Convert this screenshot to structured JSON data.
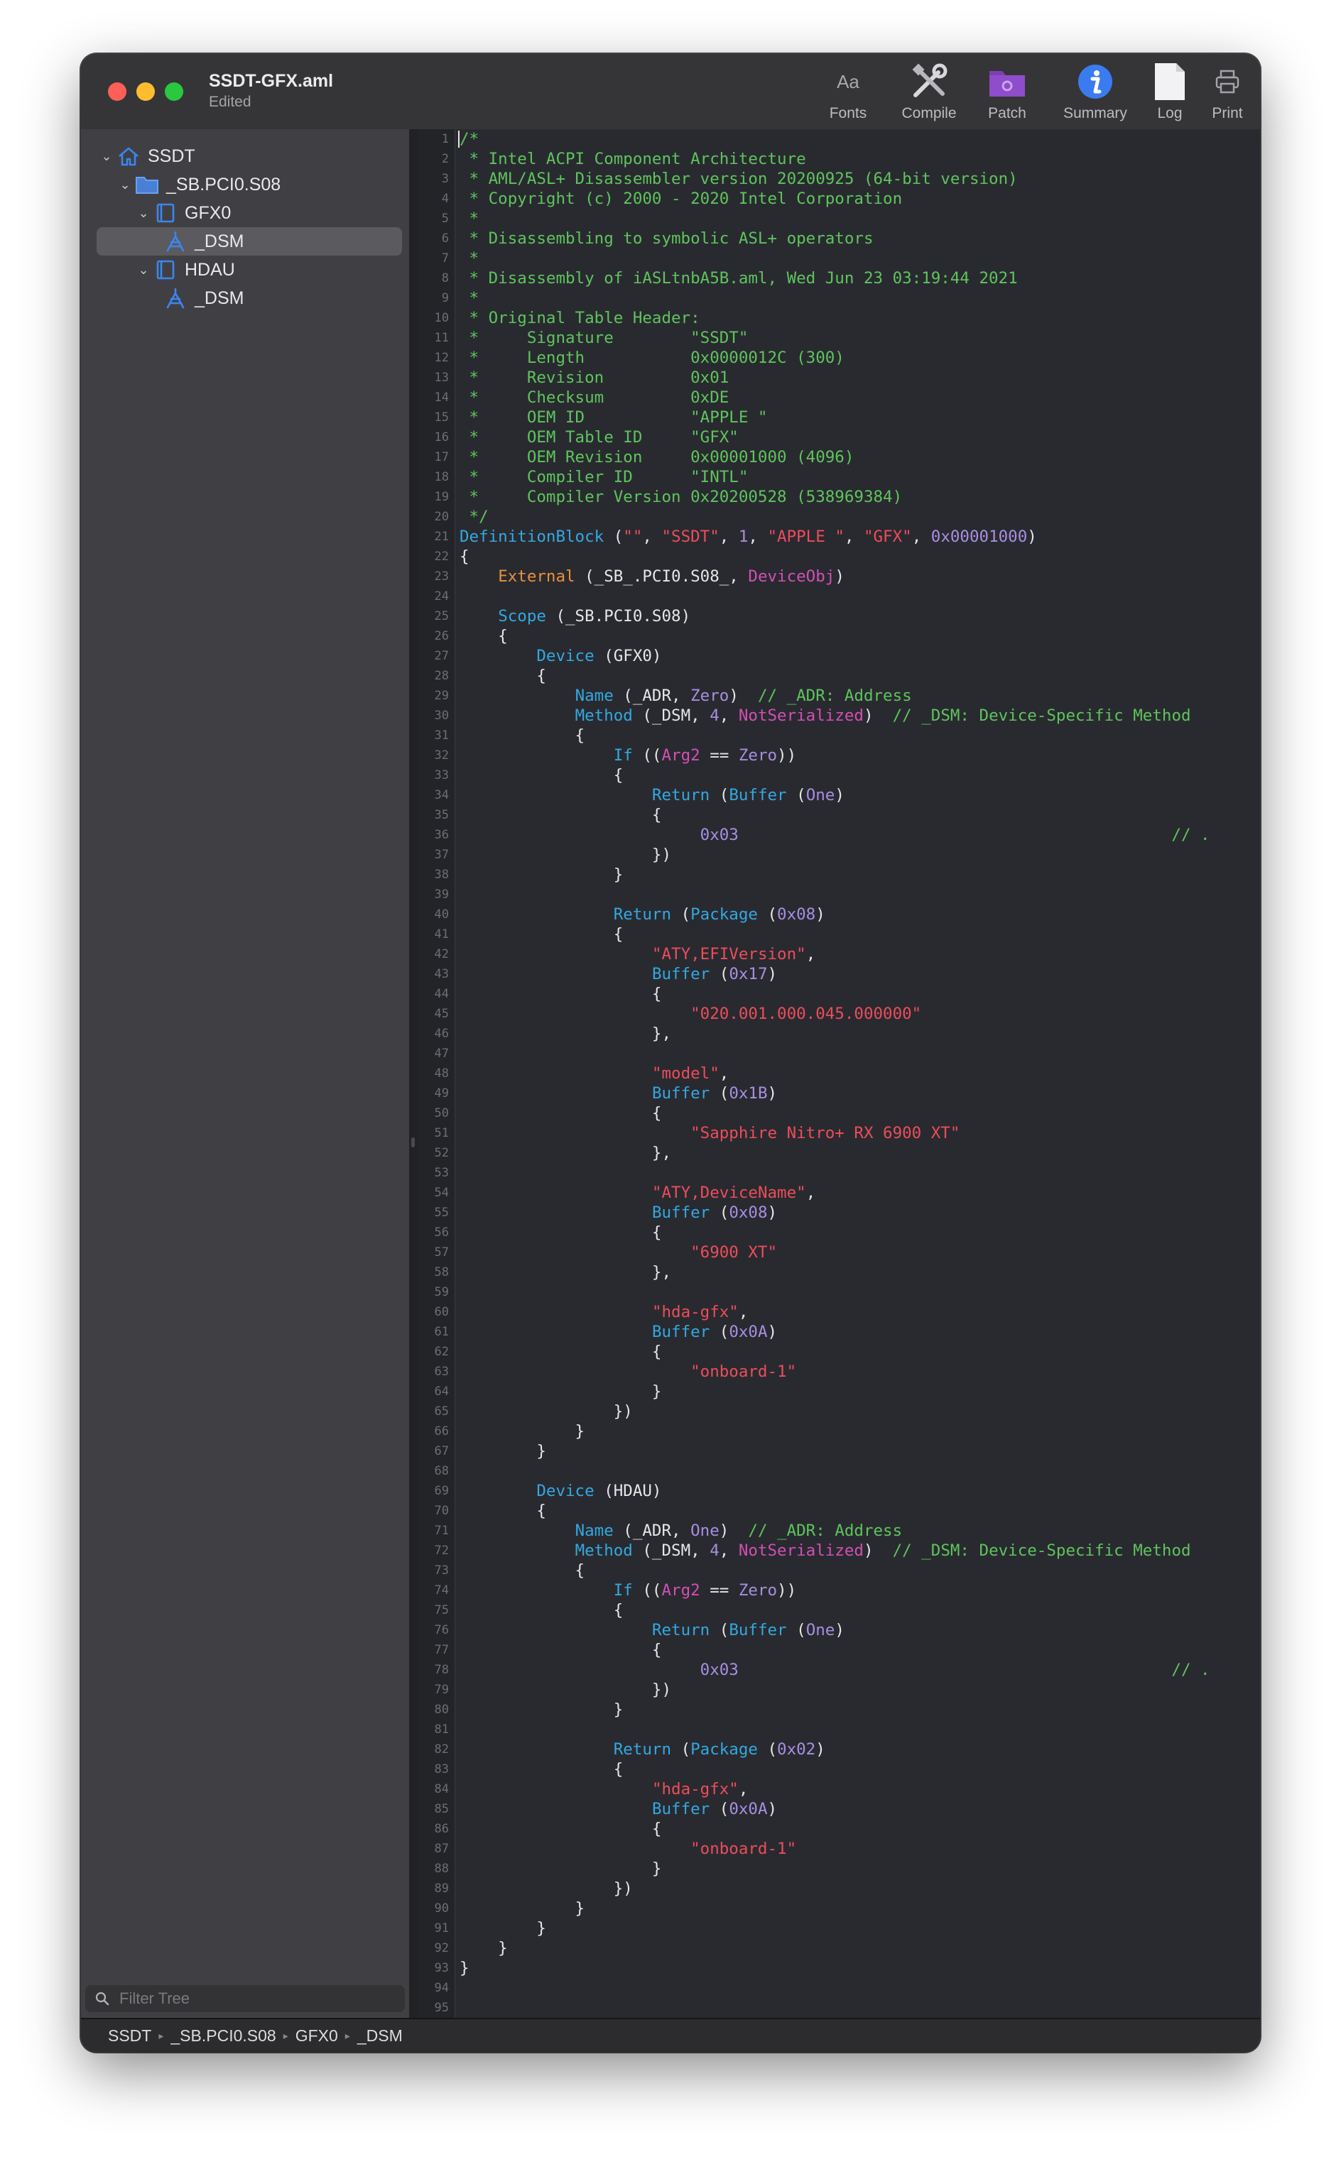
{
  "window": {
    "title": "SSDT-GFX.aml",
    "subtitle": "Edited"
  },
  "toolbar": {
    "fonts_label": "Fonts",
    "fonts_glyph": "Aa",
    "compile_label": "Compile",
    "patch_label": "Patch",
    "summary_label": "Summary",
    "log_label": "Log",
    "print_label": "Print"
  },
  "tree": [
    {
      "label": "SSDT",
      "icon": "house-icon",
      "expanded": true
    },
    {
      "label": "_SB.PCI0.S08",
      "icon": "folder-icon",
      "expanded": true
    },
    {
      "label": "GFX0",
      "icon": "device-icon",
      "expanded": true
    },
    {
      "label": "_DSM",
      "icon": "method-icon",
      "selected": true
    },
    {
      "label": "HDAU",
      "icon": "device-icon",
      "expanded": true
    },
    {
      "label": "_DSM",
      "icon": "method-icon"
    }
  ],
  "filter": {
    "placeholder": "Filter Tree"
  },
  "breadcrumb": [
    "SSDT",
    "_SB.PCI0.S08",
    "GFX0",
    "_DSM"
  ],
  "line_count": 95,
  "code_lines": [
    "/*",
    " * Intel ACPI Component Architecture",
    " * AML/ASL+ Disassembler version 20200925 (64-bit version)",
    " * Copyright (c) 2000 - 2020 Intel Corporation",
    " *",
    " * Disassembling to symbolic ASL+ operators",
    " *",
    " * Disassembly of iASLtnbA5B.aml, Wed Jun 23 03:19:44 2021",
    " *",
    " * Original Table Header:",
    " *     Signature        \"SSDT\"",
    " *     Length           0x0000012C (300)",
    " *     Revision         0x01",
    " *     Checksum         0xDE",
    " *     OEM ID           \"APPLE \"",
    " *     OEM Table ID     \"GFX\"",
    " *     OEM Revision     0x00001000 (4096)",
    " *     Compiler ID      \"INTL\"",
    " *     Compiler Version 0x20200528 (538969384)",
    " */",
    "DefinitionBlock (\"\", \"SSDT\", 1, \"APPLE \", \"GFX\", 0x00001000)",
    "{",
    "    External (_SB_.PCI0.S08_, DeviceObj)",
    "",
    "    Scope (_SB.PCI0.S08)",
    "    {",
    "        Device (GFX0)",
    "        {",
    "            Name (_ADR, Zero)  // _ADR: Address",
    "            Method (_DSM, 4, NotSerialized)  // _DSM: Device-Specific Method",
    "            {",
    "                If ((Arg2 == Zero))",
    "                {",
    "                    Return (Buffer (One)",
    "                    {",
    "                         0x03                                             // .",
    "                    })",
    "                }",
    "",
    "                Return (Package (0x08)",
    "                {",
    "                    \"ATY,EFIVersion\",",
    "                    Buffer (0x17)",
    "                    {",
    "                        \"020.001.000.045.000000\"",
    "                    },",
    "",
    "                    \"model\",",
    "                    Buffer (0x1B)",
    "                    {",
    "                        \"Sapphire Nitro+ RX 6900 XT\"",
    "                    },",
    "",
    "                    \"ATY,DeviceName\",",
    "                    Buffer (0x08)",
    "                    {",
    "                        \"6900 XT\"",
    "                    },",
    "",
    "                    \"hda-gfx\",",
    "                    Buffer (0x0A)",
    "                    {",
    "                        \"onboard-1\"",
    "                    }",
    "                })",
    "            }",
    "        }",
    "",
    "        Device (HDAU)",
    "        {",
    "            Name (_ADR, One)  // _ADR: Address",
    "            Method (_DSM, 4, NotSerialized)  // _DSM: Device-Specific Method",
    "            {",
    "                If ((Arg2 == Zero))",
    "                {",
    "                    Return (Buffer (One)",
    "                    {",
    "                         0x03                                             // .",
    "                    })",
    "                }",
    "",
    "                Return (Package (0x02)",
    "                {",
    "                    \"hda-gfx\",",
    "                    Buffer (0x0A)",
    "                    {",
    "                        \"onboard-1\"",
    "                    }",
    "                })",
    "            }",
    "        }",
    "    }",
    "}",
    "",
    ""
  ],
  "colors": {
    "comment": "#5ec45c",
    "keyword": "#33a8e0",
    "string": "#ec4d5a",
    "number": "#a88ee2",
    "external": "#e8923a",
    "deviceobj": "#d24fb4",
    "plain": "#e6e6e6"
  }
}
